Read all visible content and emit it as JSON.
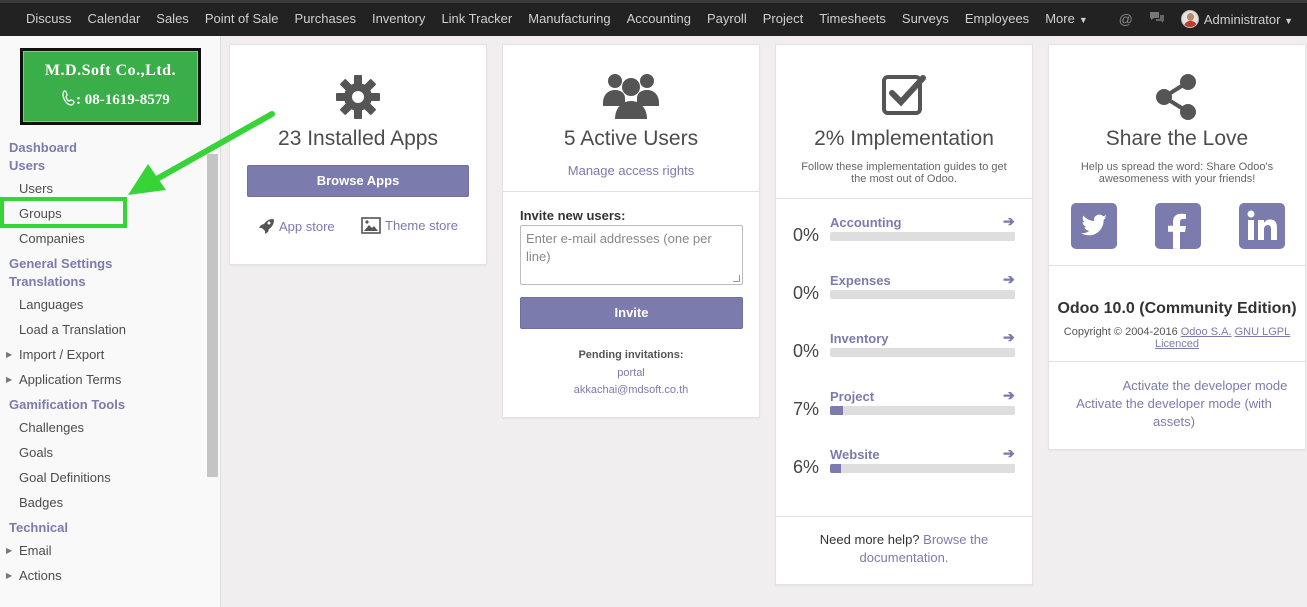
{
  "topbar": {
    "nav": [
      "Discuss",
      "Calendar",
      "Sales",
      "Point of Sale",
      "Purchases",
      "Inventory",
      "Link Tracker",
      "Manufacturing",
      "Accounting",
      "Payroll",
      "Project",
      "Timesheets",
      "Surveys",
      "Employees"
    ],
    "more_label": "More",
    "user_name": "Administrator"
  },
  "sidebar": {
    "logo_title": "M.D.Soft Co.,Ltd.",
    "logo_phone": ": 08-1619-8579",
    "sections": {
      "dashboard": "Dashboard",
      "users": "Users",
      "general_settings": "General Settings",
      "translations": "Translations",
      "gamification": "Gamification Tools",
      "technical": "Technical"
    },
    "items": {
      "users": "Users",
      "groups": "Groups",
      "companies": "Companies",
      "languages": "Languages",
      "load_translation": "Load a Translation",
      "import_export": "Import / Export",
      "application_terms": "Application Terms",
      "challenges": "Challenges",
      "goals": "Goals",
      "goal_definitions": "Goal Definitions",
      "badges": "Badges",
      "email": "Email",
      "actions": "Actions"
    }
  },
  "apps_card": {
    "title": "23 Installed Apps",
    "browse_button": "Browse Apps",
    "app_store": "App store",
    "theme_store": "Theme store"
  },
  "users_card": {
    "title": "5 Active Users",
    "manage_link": "Manage access rights",
    "invite_label": "Invite new users:",
    "email_placeholder": "Enter e-mail addresses (one per line)",
    "invite_button": "Invite",
    "pending_label": "Pending invitations:",
    "pending": [
      "portal",
      "akkachai@mdsoft.co.th"
    ]
  },
  "impl_card": {
    "title": "2% Implementation",
    "subtitle": "Follow these implementation guides to get the most out of Odoo.",
    "rows": [
      {
        "pct_label": "0%",
        "name": "Accounting",
        "progress": 0
      },
      {
        "pct_label": "0%",
        "name": "Expenses",
        "progress": 0
      },
      {
        "pct_label": "0%",
        "name": "Inventory",
        "progress": 0
      },
      {
        "pct_label": "7%",
        "name": "Project",
        "progress": 0.07
      },
      {
        "pct_label": "6%",
        "name": "Website",
        "progress": 0.06
      }
    ],
    "help_text": "Need more help?",
    "help_link": "Browse the documentation."
  },
  "share_card": {
    "title": "Share the Love",
    "subtitle": "Help us spread the word: Share Odoo's awesomeness with your friends!",
    "social_icons": [
      "twitter-icon",
      "facebook-icon",
      "linkedin-icon"
    ],
    "version": "Odoo 10.0 (Community Edition)",
    "copyright": "Copyright © 2004-2016",
    "odoo_link": "Odoo S.A.",
    "license_link": "GNU LGPL Licenced",
    "dev_mode": "Activate the developer mode",
    "dev_mode_assets": "Activate the developer mode (with assets)"
  },
  "colors": {
    "accent": "#7c7bad",
    "topbar": "#222222",
    "highlight": "#37d437",
    "logo_green": "#3aae48"
  }
}
